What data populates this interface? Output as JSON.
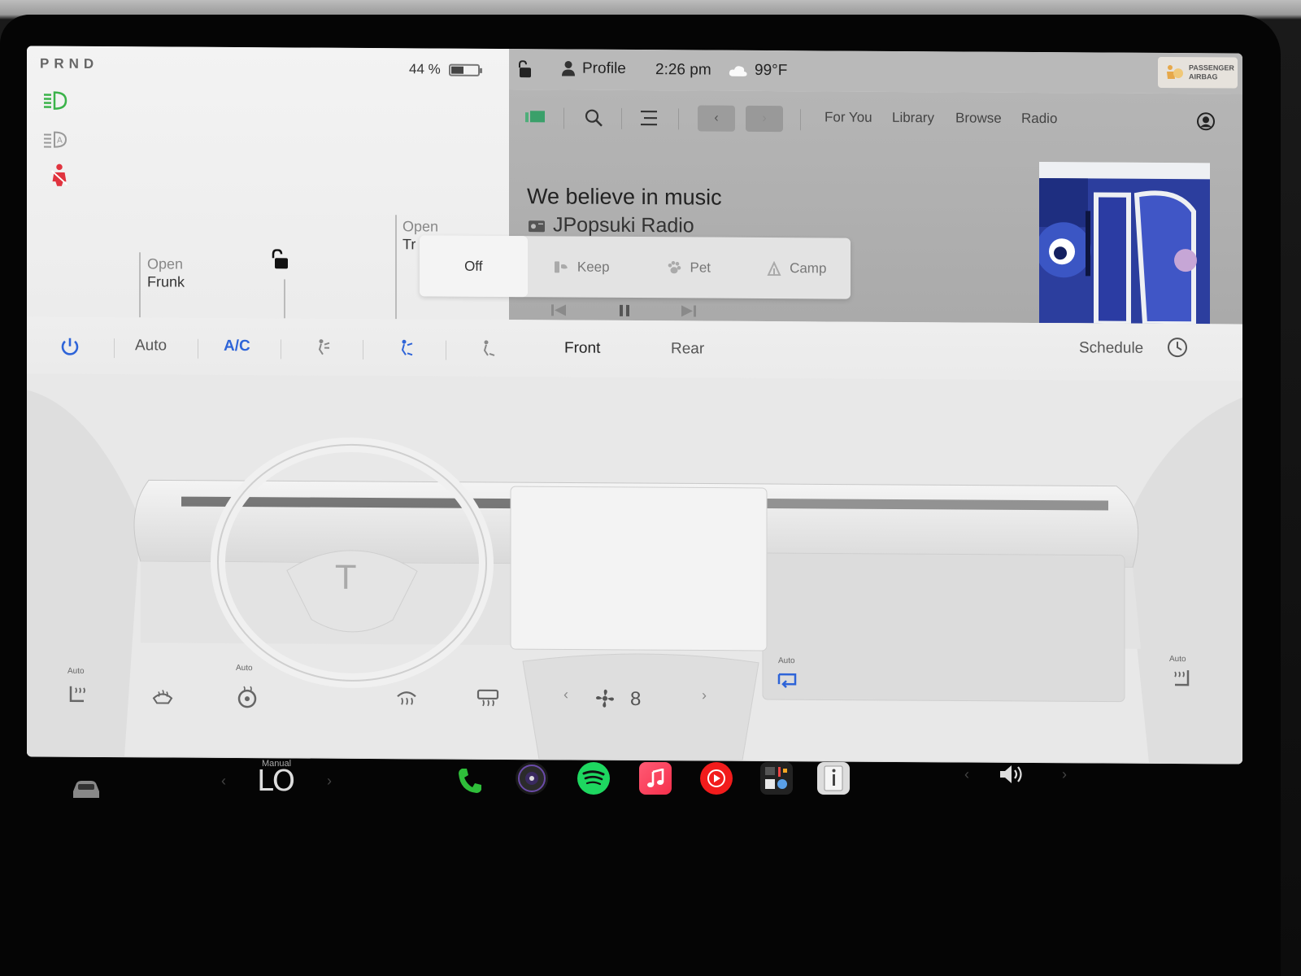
{
  "car": {
    "gear": "PRND",
    "battery_percent": "44 %",
    "battery_level": 0.44,
    "frunk_open": "Open",
    "frunk_label": "Frunk",
    "trunk_open": "Open",
    "trunk_label": "Tr"
  },
  "status_bar": {
    "profile_label": "Profile",
    "time": "2:26 pm",
    "temperature": "99°F",
    "airbag_line1": "PASSENGER",
    "airbag_line2": "AIRBAG"
  },
  "media": {
    "tabs": [
      "For You",
      "Library",
      "Browse",
      "Radio"
    ],
    "headline": "We believe in music",
    "station": "JPopsuki Radio"
  },
  "cabin_overheat": {
    "options": [
      "Off",
      "Keep",
      "Pet",
      "Camp"
    ],
    "selected": "Off"
  },
  "climate": {
    "auto_label": "Auto",
    "ac_label": "A/C",
    "front_label": "Front",
    "rear_label": "Rear",
    "schedule_label": "Schedule",
    "fan_speed": "8",
    "auto_small": "Auto",
    "accent_color": "#2e64d8"
  },
  "dock": {
    "temp_mode": "Manual",
    "temp_value": "LO",
    "apps": [
      "phone-icon",
      "camera-icon",
      "spotify-icon",
      "music-icon",
      "youtube-music-icon",
      "toybox-icon",
      "manual-icon"
    ]
  }
}
